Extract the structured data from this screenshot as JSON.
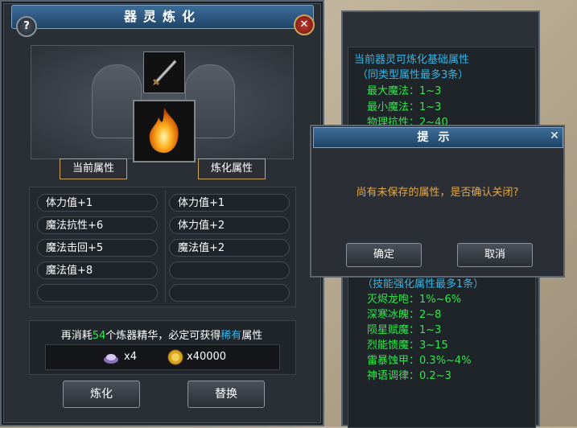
{
  "main_window": {
    "title": "器灵炼化",
    "help_icon": "?",
    "close_icon": "✕",
    "tab_current": "当前属性",
    "tab_refined": "炼化属性",
    "current_attrs": [
      "体力值+1",
      "魔法抗性+6",
      "魔法击回+5",
      "魔法值+8",
      ""
    ],
    "refined_attrs": [
      "体力值+1",
      "体力值+2",
      "魔法值+2",
      "",
      ""
    ],
    "hint_prefix": "再消耗",
    "hint_count": "54",
    "hint_middle": "个炼器精华，必定可获得",
    "hint_rare": "稀有",
    "hint_suffix": "属性",
    "material_qty": "x4",
    "gold_qty": "x40000",
    "refine_button": "炼化",
    "replace_button": "替换"
  },
  "side_panel": {
    "header": "当前器灵可炼化基础属性",
    "subheader": "（同类型属性最多3条）",
    "base_attrs": [
      {
        "name": "最大魔法：",
        "value": "1~3"
      },
      {
        "name": "最小魔法：",
        "value": "1~3"
      },
      {
        "name": "物理抗性：",
        "value": "2~40"
      }
    ],
    "rare_subheader": "（技能强化属性最多1条）",
    "rare_attrs": [
      {
        "name": "灭烬龙咆：",
        "value": "1%~6%"
      },
      {
        "name": "深寒冰魄：",
        "value": "2~8"
      },
      {
        "name": "陨星赋魔：",
        "value": "1~3"
      },
      {
        "name": "烈能馈魔：",
        "value": "3~15"
      },
      {
        "name": "雷暴蚀甲：",
        "value": "0.3%~4%"
      },
      {
        "name": "神语调律：",
        "value": "0.2~3"
      }
    ]
  },
  "dialog": {
    "title": "提示",
    "message": "尚有未保存的属性，是否确认关闭?",
    "confirm_button": "确定",
    "cancel_button": "取消",
    "close_icon": "✕"
  },
  "colors": {
    "cyan": "#33b6e8",
    "green": "#2fe84a",
    "gold": "#e0a84a",
    "title_blue": "#2d5c88"
  }
}
